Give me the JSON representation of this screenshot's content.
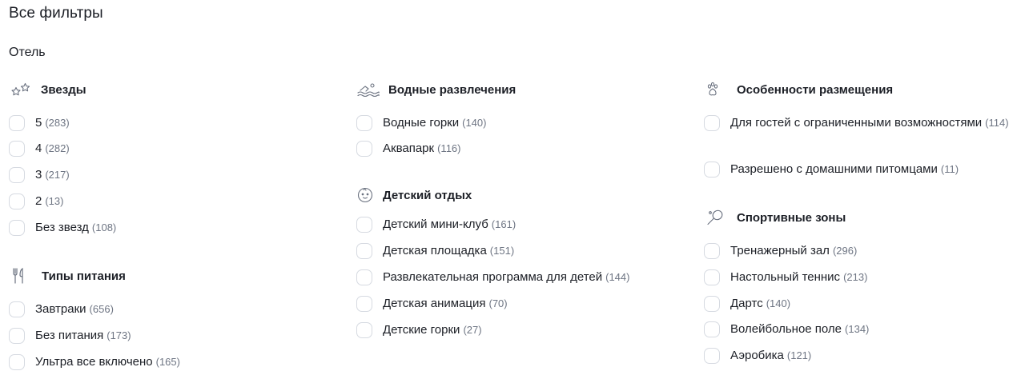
{
  "page_title": "Все фильтры",
  "section_title": "Отель",
  "groups": {
    "stars": {
      "title": "Звезды",
      "icon": "stars-icon",
      "items": [
        {
          "label": "5",
          "count": "(283)"
        },
        {
          "label": "4",
          "count": "(282)"
        },
        {
          "label": "3",
          "count": "(217)"
        },
        {
          "label": "2",
          "count": "(13)"
        },
        {
          "label": "Без звезд",
          "count": "(108)"
        }
      ]
    },
    "food": {
      "title": "Типы питания",
      "icon": "fork-knife-icon",
      "items": [
        {
          "label": "Завтраки",
          "count": "(656)"
        },
        {
          "label": "Без питания",
          "count": "(173)"
        },
        {
          "label": "Ультра все включено",
          "count": "(165)"
        }
      ]
    },
    "water": {
      "title": "Водные развлечения",
      "icon": "swimmer-icon",
      "items": [
        {
          "label": "Водные горки",
          "count": "(140)"
        },
        {
          "label": "Аквапарк",
          "count": "(116)"
        }
      ]
    },
    "kids": {
      "title": "Детский отдых",
      "icon": "baby-face-icon",
      "items": [
        {
          "label": "Детский мини-клуб",
          "count": "(161)"
        },
        {
          "label": "Детская площадка",
          "count": "(151)"
        },
        {
          "label": "Развлекательная программа для детей",
          "count": "(144)"
        },
        {
          "label": "Детская анимация",
          "count": "(70)"
        },
        {
          "label": "Детские горки",
          "count": "(27)"
        }
      ]
    },
    "accommodation": {
      "title": "Особенности размещения",
      "icon": "paw-icon",
      "items": [
        {
          "label": "Для гостей с ограниченными возможностями",
          "count": "(114)"
        },
        {
          "label": "Разрешено с домашними питомцами",
          "count": "(11)"
        }
      ]
    },
    "sport": {
      "title": "Спортивные зоны",
      "icon": "tennis-racket-icon",
      "items": [
        {
          "label": "Тренажерный зал",
          "count": "(296)"
        },
        {
          "label": "Настольный теннис",
          "count": "(213)"
        },
        {
          "label": "Дартс",
          "count": "(140)"
        },
        {
          "label": "Волейбольное поле",
          "count": "(134)"
        },
        {
          "label": "Аэробика",
          "count": "(121)"
        }
      ]
    }
  }
}
